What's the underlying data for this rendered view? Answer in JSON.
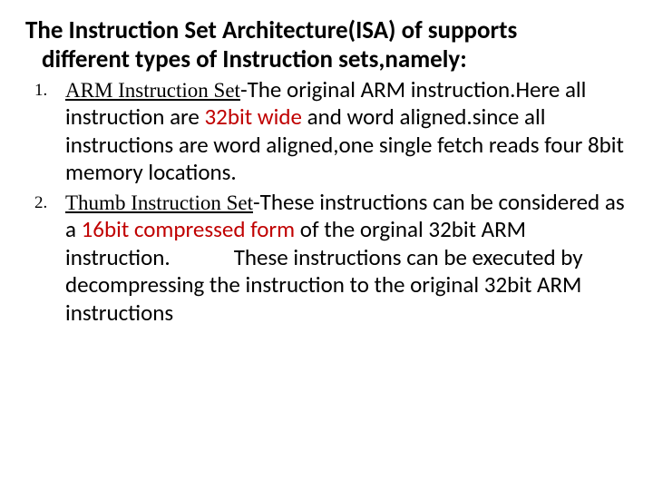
{
  "title": {
    "line1": "The Instruction Set Architecture(ISA) of supports",
    "line2": "different types of  Instruction sets,namely:"
  },
  "items": [
    {
      "name": "ARM Instruction Set",
      "dash": "-",
      "pre": "The original ARM instruction.Here all instruction are ",
      "hl": "32bit wide",
      "post": " and word aligned.since all instructions are word aligned,one single fetch reads four 8bit memory locations."
    },
    {
      "name": "Thumb Instruction Set",
      "dash": "-",
      "pre": "These instructions can be considered as a ",
      "hl": "16bit compressed form",
      "post1": " of the orginal 32bit ARM instruction.",
      "post2": "These instructions can be executed  by decompressing the instruction to the original 32bit ARM instructions"
    }
  ]
}
